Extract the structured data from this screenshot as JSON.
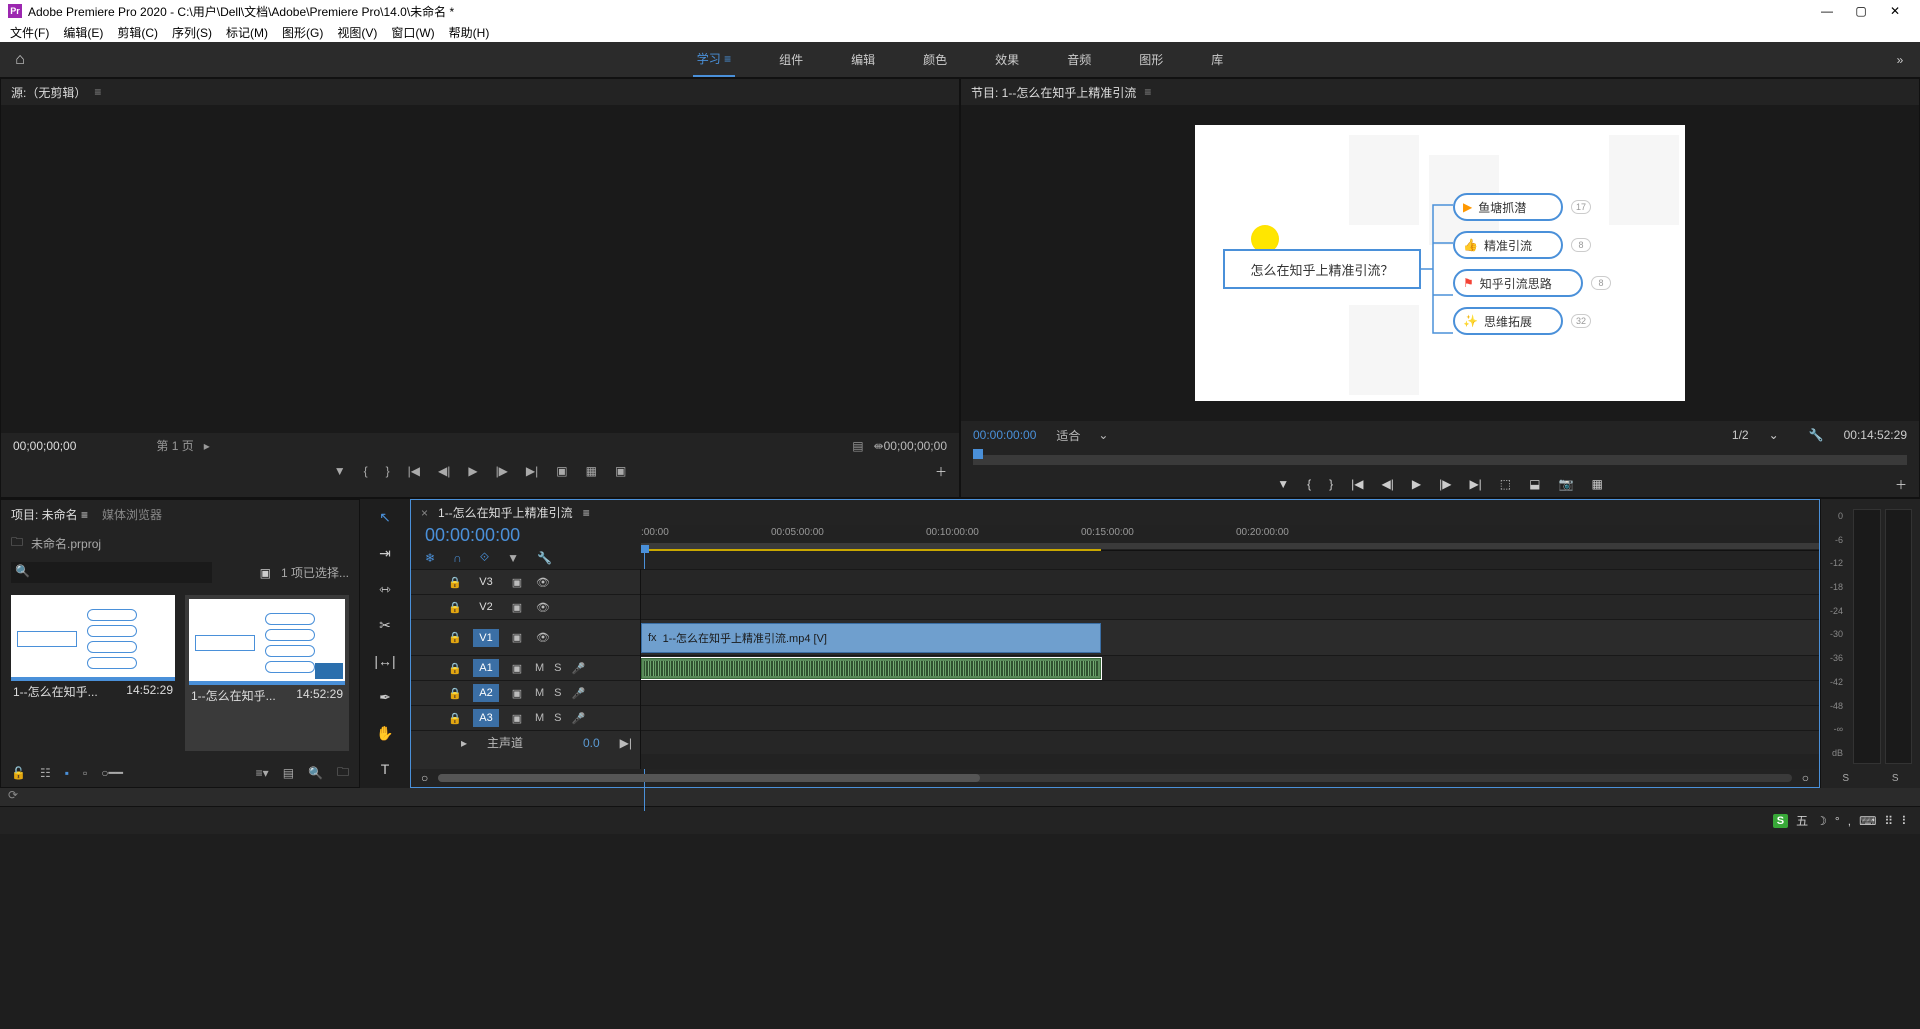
{
  "titlebar": {
    "app_icon_text": "Pr",
    "title": "Adobe Premiere Pro 2020 - C:\\用户\\Dell\\文档\\Adobe\\Premiere Pro\\14.0\\未命名 *"
  },
  "menubar": [
    "文件(F)",
    "编辑(E)",
    "剪辑(C)",
    "序列(S)",
    "标记(M)",
    "图形(G)",
    "视图(V)",
    "窗口(W)",
    "帮助(H)"
  ],
  "workspaces": {
    "tabs": [
      "学习",
      "组件",
      "编辑",
      "颜色",
      "效果",
      "音频",
      "图形",
      "库"
    ],
    "active_index": 0
  },
  "source_panel": {
    "title": "源:（无剪辑）",
    "timecode_left": "00;00;00;00",
    "page_text": "第 1 页",
    "timecode_right": "00;00;00;00"
  },
  "program_panel": {
    "title": "节目: 1--怎么在知乎上精准引流",
    "timecode": "00:00:00:00",
    "zoom_label": "适合",
    "scale_label": "1/2",
    "duration": "00:14:52:29",
    "mindmap": {
      "root": "怎么在知乎上精准引流？",
      "nodes": [
        {
          "label": "鱼塘抓潜",
          "badge": "17",
          "icon_color": "#ff9800"
        },
        {
          "label": "精准引流",
          "badge": "8",
          "icon_color": "#4caf50"
        },
        {
          "label": "知乎引流思路",
          "badge": "8",
          "icon_color": "#f44336"
        },
        {
          "label": "思维拓展",
          "badge": "32",
          "icon_color": "#2196f3"
        }
      ]
    }
  },
  "project_panel": {
    "tabs": [
      "项目: 未命名",
      "媒体浏览器"
    ],
    "filename": "未命名.prproj",
    "search_placeholder": "",
    "selection_text": "1 项已选择...",
    "items": [
      {
        "name": "1--怎么在知乎...",
        "duration": "14:52:29",
        "selected": false
      },
      {
        "name": "1--怎么在知乎...",
        "duration": "14:52:29",
        "selected": true
      }
    ]
  },
  "tools": [
    "▲",
    "⇉",
    "⇿",
    "✂",
    "↔",
    "✎",
    "✋",
    "T"
  ],
  "timeline": {
    "sequence_name": "1--怎么在知乎上精准引流",
    "timecode": "00:00:00:00",
    "ruler_ticks": [
      ":00:00",
      "00:05:00:00",
      "00:10:00:00",
      "00:15:00:00",
      "00:20:00:00"
    ],
    "video_tracks": [
      {
        "label": "V3",
        "on": false
      },
      {
        "label": "V2",
        "on": false
      },
      {
        "label": "V1",
        "on": true
      }
    ],
    "audio_tracks": [
      {
        "label": "A1",
        "on": true
      },
      {
        "label": "A2",
        "on": true
      },
      {
        "label": "A3",
        "on": true
      }
    ],
    "v1_clip_label": "1--怎么在知乎上精准引流.mp4 [V]",
    "master_label": "主声道",
    "master_value": "0.0"
  },
  "meters": {
    "scale": [
      "0",
      "-6",
      "-12",
      "-18",
      "-24",
      "-30",
      "-36",
      "-42",
      "-48",
      "-∞",
      "dB"
    ],
    "solo_labels": [
      "S",
      "S"
    ]
  },
  "taskbar": {
    "ime": "S",
    "ime_text": "五"
  }
}
